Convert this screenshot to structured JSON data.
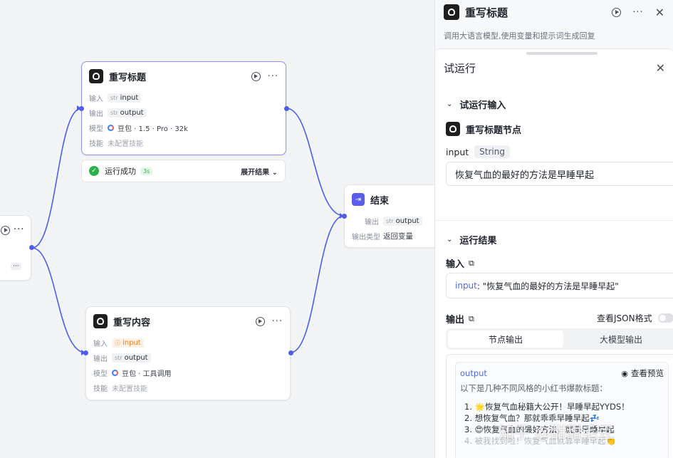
{
  "canvas": {
    "partial_node": {
      "dots": "···"
    },
    "rewrite_title_node": {
      "title": "重写标题",
      "input_label": "输入",
      "input_type": "str",
      "input_var": "input",
      "output_label": "输出",
      "output_type": "str",
      "output_var": "output",
      "model_label": "模型",
      "model_value": "豆包 · 1.5 · Pro · 32k",
      "skill_label": "技能",
      "skill_value": "未配置技能"
    },
    "status": {
      "text": "运行成功",
      "duration": "3s",
      "expand": "展开结果 ⌄"
    },
    "end_node": {
      "title": "结束",
      "output_label": "输出",
      "output_type": "str",
      "output_var": "output",
      "output_type_label": "输出类型",
      "output_type_value": "返回变量"
    },
    "rewrite_content_node": {
      "title": "重写内容",
      "input_label": "输入",
      "input_var": "input",
      "output_label": "输出",
      "output_type": "str",
      "output_var": "output",
      "model_label": "模型",
      "model_value": "豆包 · 工具调用",
      "skill_label": "技能",
      "skill_value": "未配置技能"
    }
  },
  "panel": {
    "title": "重写标题",
    "description": "调用大语言模型,使用变量和提示词生成回复",
    "trial": {
      "title": "试运行",
      "input_section": "试运行输入",
      "node_name": "重写标题节点",
      "input_name": "input",
      "input_type": "String",
      "input_value": "恢复气血的最好的方法是早睡早起",
      "result_section": "运行结果",
      "input_label": "输入",
      "input_display_key": "input",
      "input_display_value": ": \"恢复气血的最好的方法是早睡早起\"",
      "output_label": "输出",
      "json_toggle_label": "查看JSON格式",
      "tabs": [
        "节点输出",
        "大模型输出"
      ],
      "output_var": "output",
      "preview_label": "查看预览",
      "output_intro": "以下是几种不同风格的小红书爆款标题：",
      "output_items": [
        "1. 🌟恢复气血秘籍大公开！早睡早起YYDS！",
        "2. 想恢复气血？那就乖乖早睡早起💤",
        "3. 😍恢复气血的最好方法，就是早睡早起",
        "4. 被我找到啦！恢复气血就靠早睡早起👏"
      ]
    }
  },
  "watermark": "知乎 @甜甜毛豆"
}
